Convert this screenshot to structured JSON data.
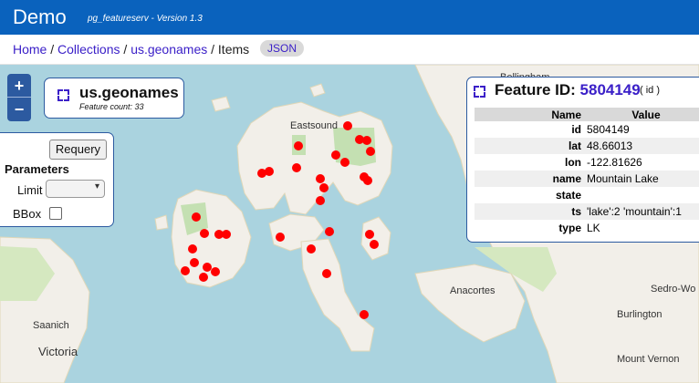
{
  "header": {
    "brand": "Demo",
    "version": "pg_featureserv - Version 1.3"
  },
  "breadcrumb": {
    "home": "Home",
    "sep1": " / ",
    "collections": "Collections",
    "sep2": " / ",
    "collection": "us.geonames",
    "sep3": " / ",
    "current": "Items",
    "json_button": "JSON"
  },
  "map": {
    "zoom_in": "+",
    "zoom_out": "−",
    "labels": {
      "eastsound": "Eastsound",
      "bellingham": "Bellingham",
      "anacortes": "Anacortes",
      "saanich": "Saanich",
      "victoria": "Victoria",
      "burlington": "Burlington",
      "sedro_wo": "Sedro-Wo",
      "mount_vernon": "Mount Vernon"
    },
    "point_color": "#ff0000",
    "water_color": "#aad3df",
    "land_color": "#f2efe9"
  },
  "collection_panel": {
    "name": "us.geonames",
    "count_text": "Feature count: 33"
  },
  "params_panel": {
    "requery_label": "Requery",
    "title": "Parameters",
    "limit_label": "Limit",
    "limit_value": "",
    "bbox_label": "BBox",
    "bbox_checked": false
  },
  "feature_panel": {
    "title_prefix": "Feature ID: ",
    "feature_id": "5804149",
    "id_label": "( id )",
    "col_name": "Name",
    "col_value": "Value",
    "rows": [
      {
        "k": "id",
        "v": "5804149"
      },
      {
        "k": "lat",
        "v": "48.66013"
      },
      {
        "k": "lon",
        "v": "-122.81626"
      },
      {
        "k": "name",
        "v": "Mountain Lake"
      },
      {
        "k": "state",
        "v": ""
      },
      {
        "k": "ts",
        "v": "'lake':2 'mountain':1"
      },
      {
        "k": "type",
        "v": "LK"
      }
    ]
  }
}
